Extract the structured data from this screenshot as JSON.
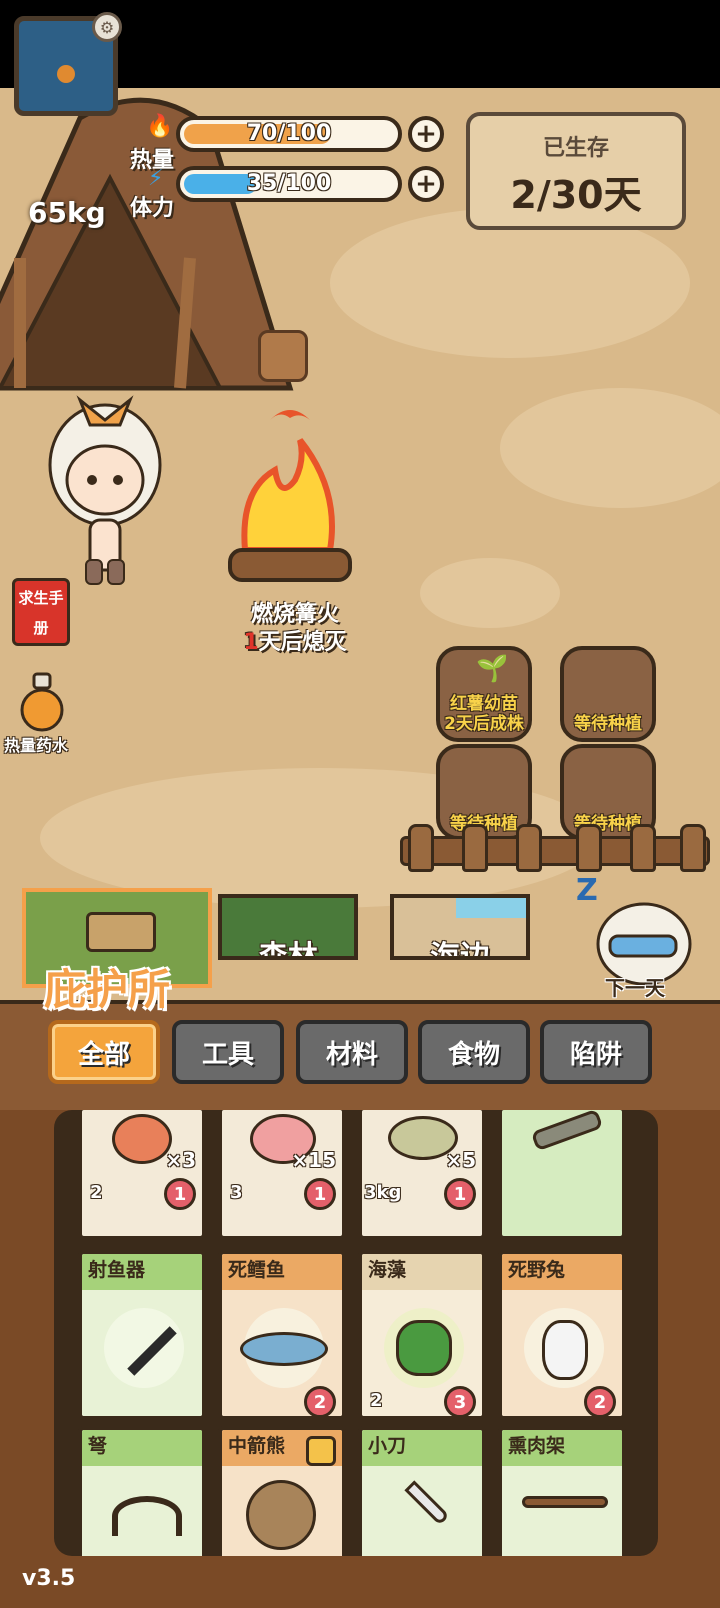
{
  "hud": {
    "weight": "65kg",
    "heat_label": "热量",
    "heat_value": "70/100",
    "heat_fraction": 0.7,
    "stamina_label": "体力",
    "stamina_value": "35/100",
    "stamina_fraction": 0.35,
    "plus_symbol": "+",
    "survived_title": "已生存",
    "survived_value": "2/30天"
  },
  "scene": {
    "campfire_label": "燃烧篝火",
    "campfire_days": "1",
    "campfire_suffix": "天后熄灭",
    "handbook_label": "求生手册",
    "potion_label": "热量药水",
    "plots": [
      {
        "line1": "红薯幼苗",
        "line2": "2天后成株"
      },
      {
        "line1": "等待种植",
        "line2": ""
      },
      {
        "line1": "等待种植",
        "line2": ""
      },
      {
        "line1": "等待种植",
        "line2": ""
      }
    ]
  },
  "locations": {
    "shelter": "庇护所",
    "forest": "森林",
    "beach": "海边",
    "next_day": "下一天"
  },
  "tabs": [
    "全部",
    "工具",
    "材料",
    "食物",
    "陷阱"
  ],
  "inventory": {
    "row0": [
      {
        "qty": "×3",
        "weight": "2",
        "count": "1",
        "color": "beige"
      },
      {
        "qty": "×15",
        "weight": "3",
        "count": "1",
        "color": "beige"
      },
      {
        "qty": "×5",
        "weight": "3kg",
        "count": "1",
        "color": "beige"
      },
      {
        "qty": "",
        "weight": "",
        "count": "",
        "color": "green"
      }
    ],
    "row1": [
      {
        "name": "射鱼器",
        "color": "green",
        "weight": "",
        "count": ""
      },
      {
        "name": "死鳕鱼",
        "color": "orange",
        "weight": "",
        "count": "2"
      },
      {
        "name": "海藻",
        "color": "beige",
        "weight": "2",
        "count": "3"
      },
      {
        "name": "死野兔",
        "color": "orange",
        "weight": "",
        "count": "2"
      }
    ],
    "row2": [
      {
        "name": "弩",
        "color": "green"
      },
      {
        "name": "中箭熊",
        "color": "orange"
      },
      {
        "name": "小刀",
        "color": "green"
      },
      {
        "name": "熏肉架",
        "color": "green"
      }
    ]
  },
  "version": "v3.5",
  "colors": {
    "heat_bar": "#f0a24a",
    "stamina_bar": "#4ab0e8",
    "active_tab": "#f4a43c"
  }
}
